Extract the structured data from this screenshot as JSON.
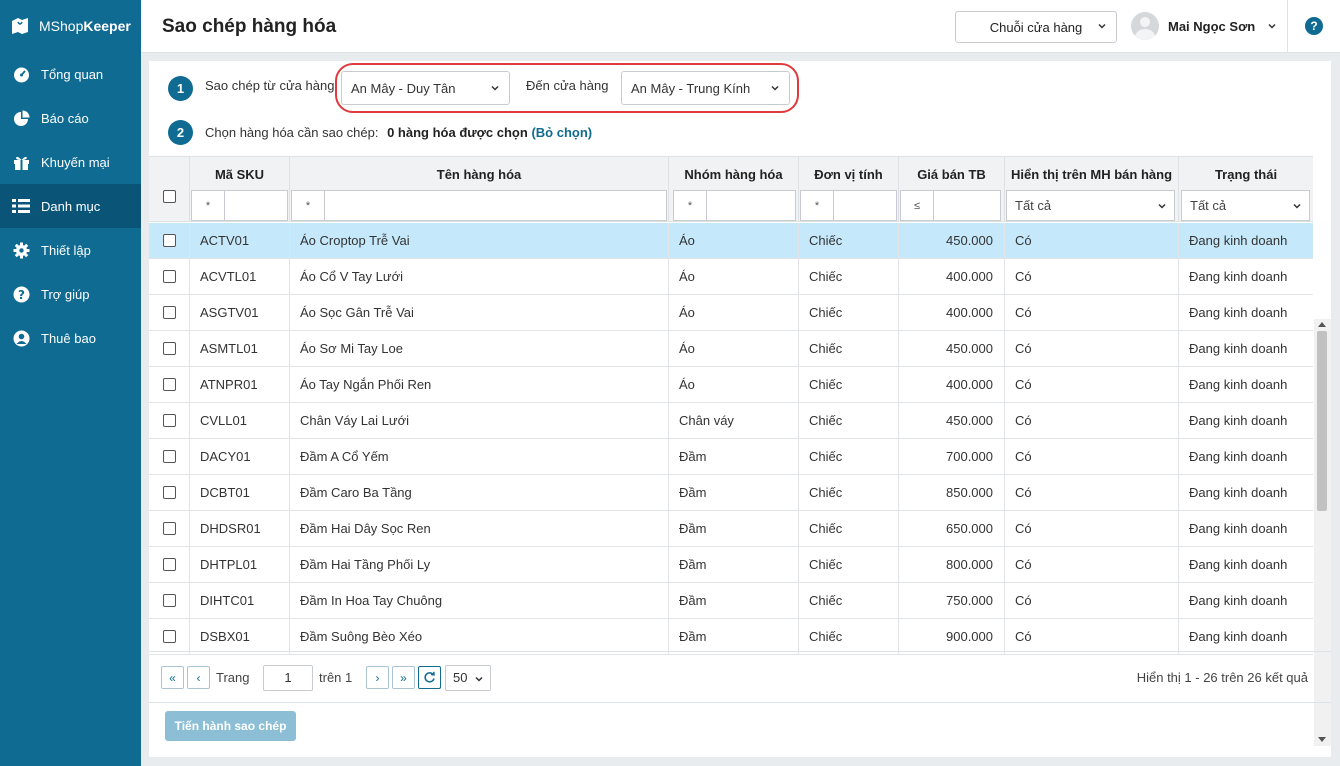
{
  "app": {
    "brand_light": "MShop",
    "brand_bold": "Keeper"
  },
  "sidebar": {
    "items": [
      {
        "label": "Tổng quan",
        "icon": "dashboard-icon"
      },
      {
        "label": "Báo cáo",
        "icon": "pie-chart-icon"
      },
      {
        "label": "Khuyến mại",
        "icon": "gift-icon"
      },
      {
        "label": "Danh mục",
        "icon": "list-icon",
        "active": true
      },
      {
        "label": "Thiết lập",
        "icon": "gear-icon"
      },
      {
        "label": "Trợ giúp",
        "icon": "help-icon"
      },
      {
        "label": "Thuê bao",
        "icon": "user-icon"
      }
    ]
  },
  "header": {
    "title": "Sao chép hàng hóa",
    "chain_label": "Chuỗi cửa hàng",
    "user_name": "Mai Ngọc Sơn",
    "help": "?"
  },
  "step1": {
    "number": "1",
    "from_label": "Sao chép từ cửa hàng",
    "from_value": "An Mây - Duy Tân",
    "to_label": "Đến cửa hàng",
    "to_value": "An Mây - Trung Kính"
  },
  "step2": {
    "number": "2",
    "label": "Chọn hàng hóa cần sao chép:",
    "count_text": "0 hàng hóa được chọn",
    "open_paren": " (",
    "deselect": "Bỏ chọn",
    "close_paren": ")"
  },
  "table": {
    "headers": {
      "sku": "Mã SKU",
      "name": "Tên hàng hóa",
      "group": "Nhóm hàng hóa",
      "unit": "Đơn vị tính",
      "price": "Giá bán TB",
      "display": "Hiển thị trên MH bán hàng",
      "status": "Trạng thái"
    },
    "filters": {
      "sku_op": "*",
      "name_op": "*",
      "group_op": "*",
      "unit_op": "*",
      "price_op": "≤",
      "display_value": "Tất cả",
      "status_value": "Tất cả"
    },
    "rows": [
      {
        "sku": "ACTV01",
        "name": "Áo Croptop Trễ Vai",
        "group": "Áo",
        "unit": "Chiếc",
        "price": "450.000",
        "display": "Có",
        "status": "Đang kinh doanh"
      },
      {
        "sku": "ACVTL01",
        "name": "Áo Cổ V Tay Lưới",
        "group": "Áo",
        "unit": "Chiếc",
        "price": "400.000",
        "display": "Có",
        "status": "Đang kinh doanh"
      },
      {
        "sku": "ASGTV01",
        "name": "Áo Sọc Gân Trễ Vai",
        "group": "Áo",
        "unit": "Chiếc",
        "price": "400.000",
        "display": "Có",
        "status": "Đang kinh doanh"
      },
      {
        "sku": "ASMTL01",
        "name": "Áo Sơ Mi Tay Loe",
        "group": "Áo",
        "unit": "Chiếc",
        "price": "450.000",
        "display": "Có",
        "status": "Đang kinh doanh"
      },
      {
        "sku": "ATNPR01",
        "name": "Áo Tay Ngắn Phối Ren",
        "group": "Áo",
        "unit": "Chiếc",
        "price": "400.000",
        "display": "Có",
        "status": "Đang kinh doanh"
      },
      {
        "sku": "CVLL01",
        "name": "Chân Váy Lai Lưới",
        "group": "Chân váy",
        "unit": "Chiếc",
        "price": "450.000",
        "display": "Có",
        "status": "Đang kinh doanh"
      },
      {
        "sku": "DACY01",
        "name": "Đầm A Cổ Yếm",
        "group": "Đầm",
        "unit": "Chiếc",
        "price": "700.000",
        "display": "Có",
        "status": "Đang kinh doanh"
      },
      {
        "sku": "DCBT01",
        "name": "Đầm Caro Ba Tầng",
        "group": "Đầm",
        "unit": "Chiếc",
        "price": "850.000",
        "display": "Có",
        "status": "Đang kinh doanh"
      },
      {
        "sku": "DHDSR01",
        "name": "Đầm Hai Dây Sọc Ren",
        "group": "Đầm",
        "unit": "Chiếc",
        "price": "650.000",
        "display": "Có",
        "status": "Đang kinh doanh"
      },
      {
        "sku": "DHTPL01",
        "name": "Đầm Hai Tầng Phối Ly",
        "group": "Đầm",
        "unit": "Chiếc",
        "price": "800.000",
        "display": "Có",
        "status": "Đang kinh doanh"
      },
      {
        "sku": "DIHTC01",
        "name": "Đầm In Hoa Tay Chuông",
        "group": "Đầm",
        "unit": "Chiếc",
        "price": "750.000",
        "display": "Có",
        "status": "Đang kinh doanh"
      },
      {
        "sku": "DSBX01",
        "name": "Đầm Suông Bèo Xéo",
        "group": "Đầm",
        "unit": "Chiếc",
        "price": "900.000",
        "display": "Có",
        "status": "Đang kinh doanh"
      }
    ]
  },
  "pager": {
    "page_label": "Trang",
    "page_value": "1",
    "of_label": "trên 1",
    "page_size": "50",
    "summary": "Hiển thị 1 - 26 trên 26 kết quả"
  },
  "actions": {
    "submit_label": "Tiến hành sao chép"
  },
  "colors": {
    "primary": "#0f6b91",
    "selected_row": "#c5e9fb",
    "highlight": "#e0393e"
  }
}
